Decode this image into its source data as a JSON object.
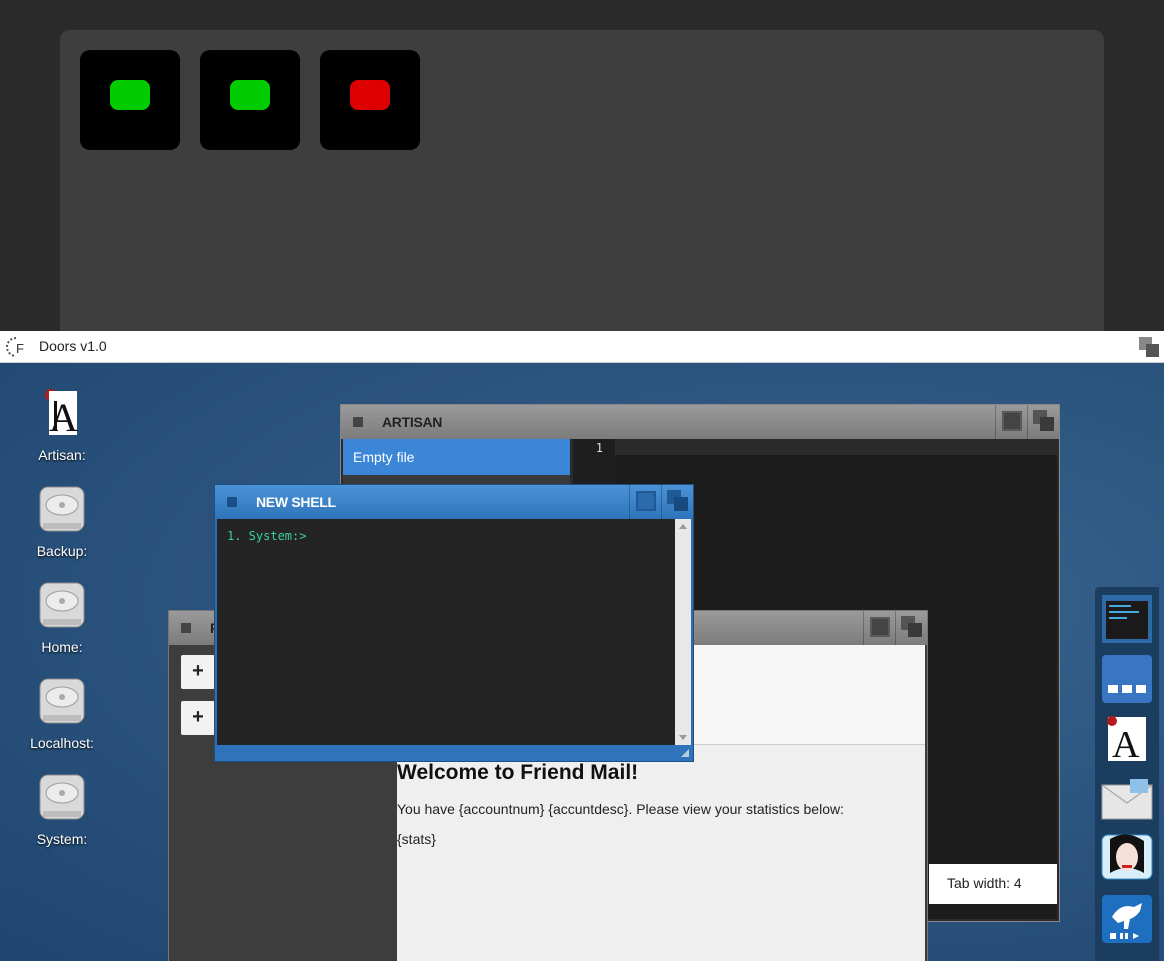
{
  "top": {
    "tiles": [
      {
        "status": "green"
      },
      {
        "status": "green"
      },
      {
        "status": "red"
      }
    ]
  },
  "taskbar": {
    "title": "Doors v1.0"
  },
  "desktop": {
    "icons": [
      {
        "label": "Artisan:",
        "icon": "artisan-icon"
      },
      {
        "label": "Backup:",
        "icon": "hard-drive-icon"
      },
      {
        "label": "Home:",
        "icon": "hard-drive-icon"
      },
      {
        "label": "Localhost:",
        "icon": "hard-drive-icon"
      },
      {
        "label": "System:",
        "icon": "hard-drive-icon"
      }
    ]
  },
  "artisan": {
    "title": "ARTISAN",
    "file_label": "Empty file",
    "line_number": "1",
    "status": "Tab width: 4"
  },
  "shell": {
    "title": "NEW SHELL",
    "prompt": "1. System:>"
  },
  "mail": {
    "title_initial": "F",
    "plus_label": "+",
    "heading": "Welcome to Friend Mail!",
    "line1": "You have {accountnum} {accuntdesc}. Please view your statistics below:",
    "line2": "{stats}"
  },
  "dock": {
    "items": [
      "shell-icon",
      "workspace-icon",
      "artisan-icon",
      "mail-icon",
      "avatar-icon",
      "media-player-icon"
    ]
  }
}
